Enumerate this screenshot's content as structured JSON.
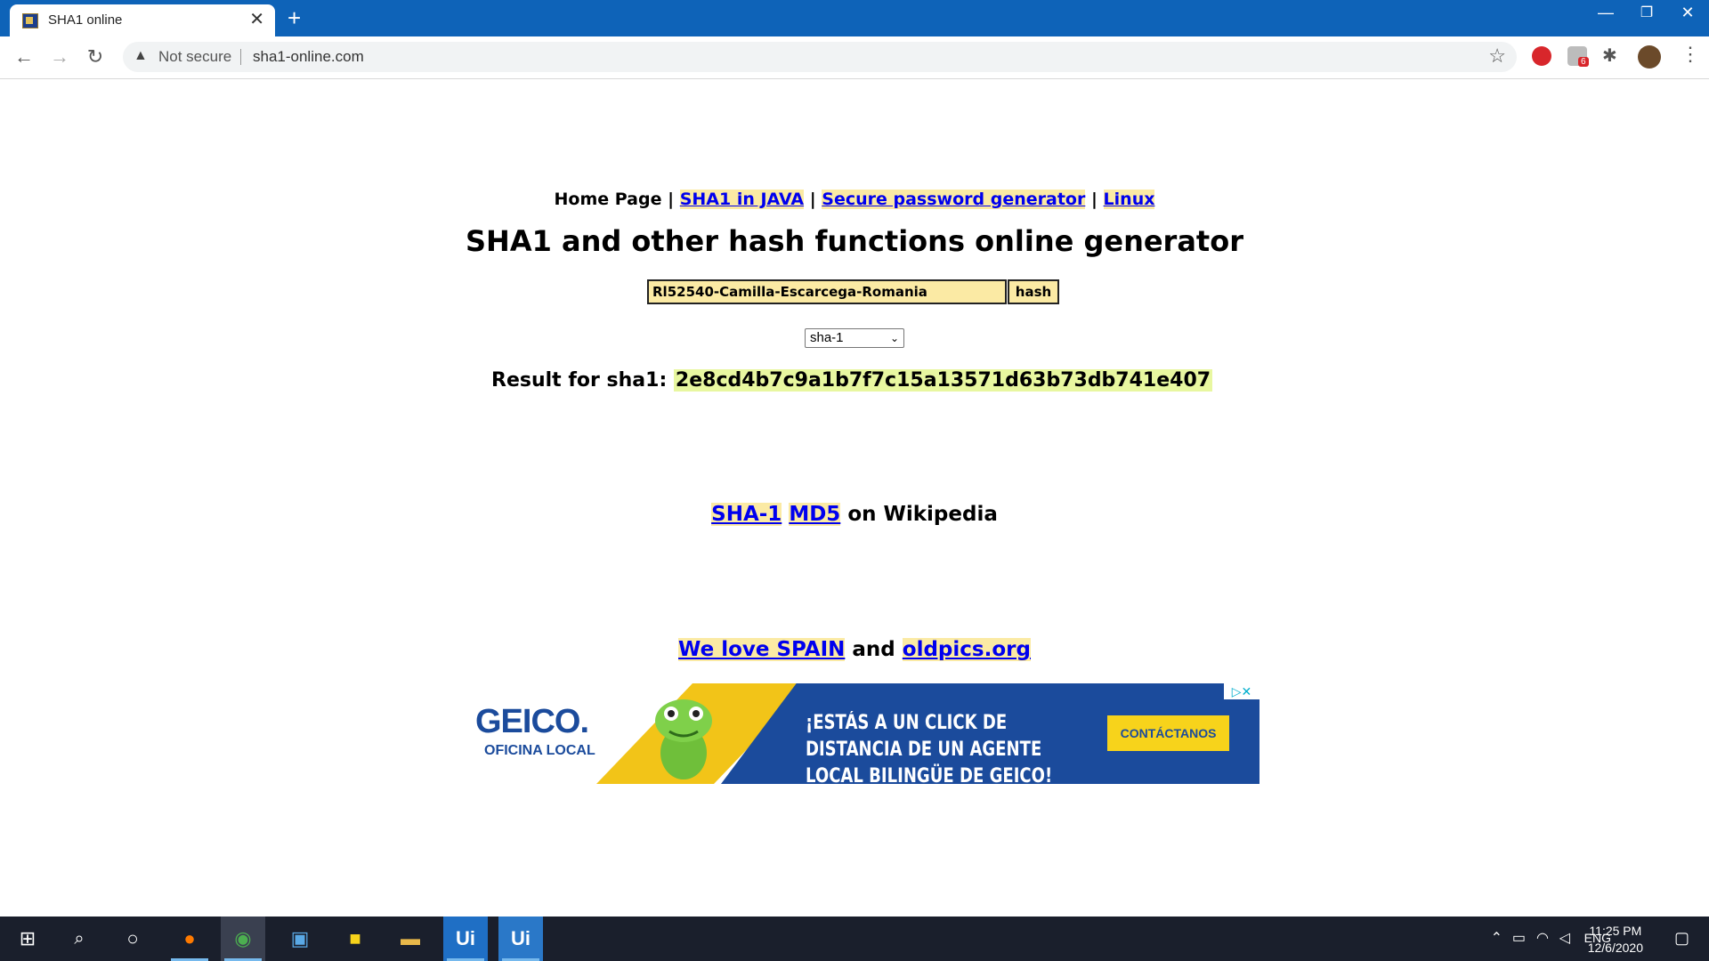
{
  "browser": {
    "tab_title": "SHA1 online",
    "security_label": "Not secure",
    "url": "sha1-online.com",
    "extension_badge": "6"
  },
  "nav": {
    "home": "Home Page",
    "sep": "|",
    "links": [
      "SHA1 in JAVA",
      "Secure password generator",
      "Linux"
    ]
  },
  "page": {
    "title": "SHA1 and other hash functions online generator",
    "input_value": "Rl52540-Camilla-Escarcega-Romania",
    "hash_button": "hash",
    "algorithm": "sha-1",
    "result_label": "Result for sha1:",
    "result_value": "2e8cd4b7c9a1b7f7c15a13571d63b73db741e407"
  },
  "wiki": {
    "link1": "SHA-1",
    "link2": "MD5",
    "suffix": "on Wikipedia"
  },
  "promo": {
    "link1": "We love SPAIN",
    "and": "and",
    "link2": "oldpics.org"
  },
  "ad": {
    "brand": "GEICO.",
    "subtitle": "OFICINA LOCAL",
    "headline": "¡ESTÁS A UN CLICK DE DISTANCIA DE UN AGENTE LOCAL BILINGÜE DE GEICO!",
    "cta": "CONTÁCTANOS"
  },
  "taskbar": {
    "lang": "ENG",
    "time": "11:25 PM",
    "date": "12/6/2020",
    "apps": [
      "Ui",
      "Ui"
    ]
  },
  "colors": {
    "titlebar": "#0e63b8",
    "link": "#0000ee",
    "link_bg": "#fbeaa4",
    "result_bg": "#e8f7a0"
  }
}
